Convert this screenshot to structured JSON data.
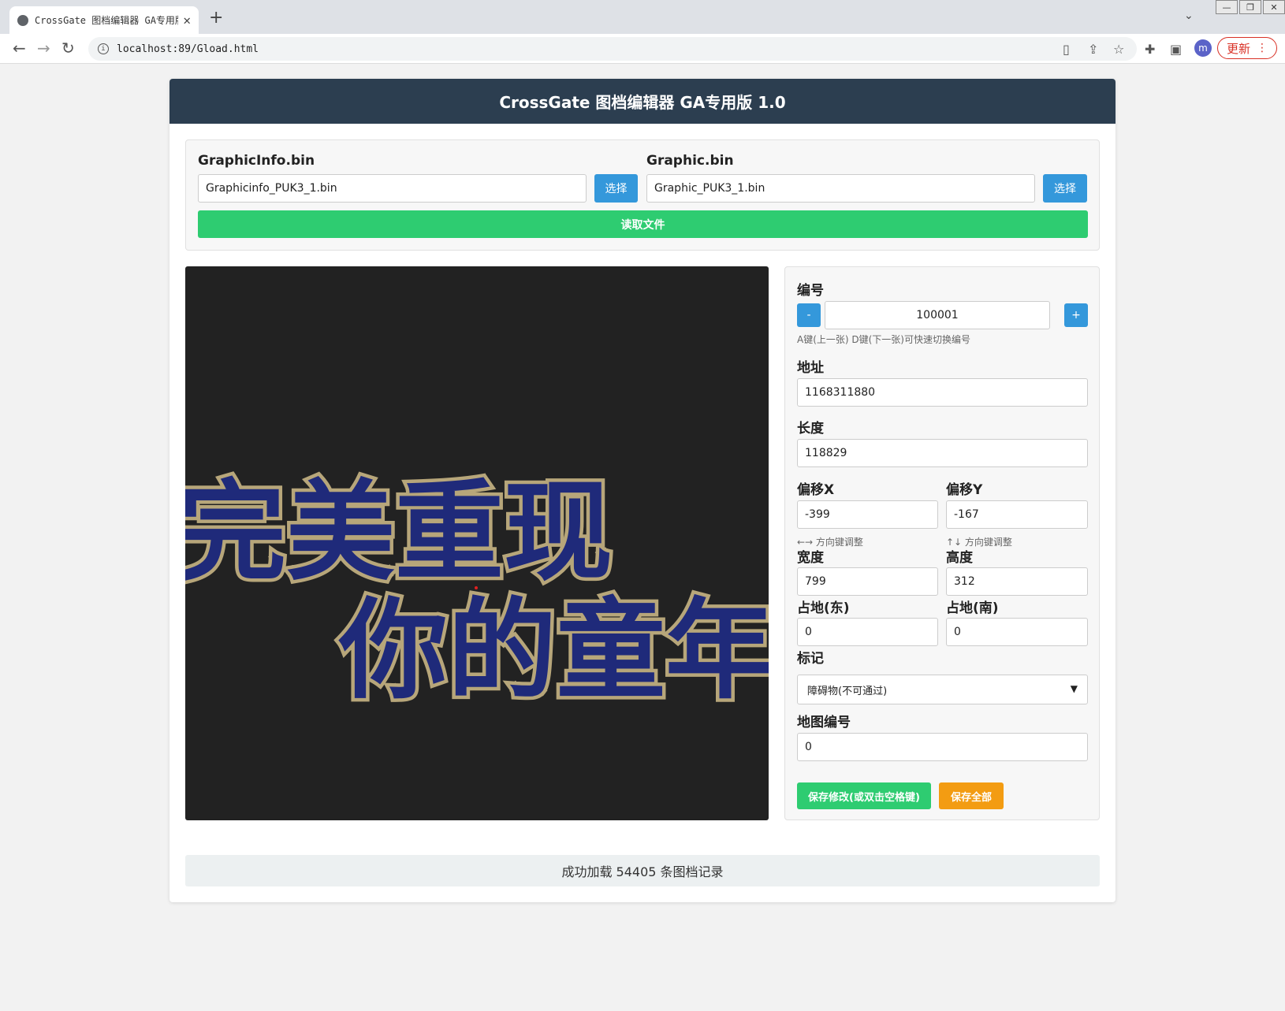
{
  "browser": {
    "tab_title": "CrossGate 图档编辑器 GA专用版",
    "url": "localhost:89/Gload.html",
    "profile_initial": "m",
    "update_label": "更新"
  },
  "app": {
    "title": "CrossGate 图档编辑器 GA专用版 1.0",
    "files": {
      "info_label": "GraphicInfo.bin",
      "info_value": "Graphicinfo_PUK3_1.bin",
      "graphic_label": "Graphic.bin",
      "graphic_value": "Graphic_PUK3_1.bin",
      "choose_label": "选择",
      "read_label": "读取文件"
    },
    "preview": {
      "line1": "完美重现",
      "line2": "你的童年"
    },
    "props": {
      "id_label": "编号",
      "id_value": "100001",
      "dec_label": "-",
      "inc_label": "+",
      "id_hint": "A键(上一张) D键(下一张)可快速切换编号",
      "addr_label": "地址",
      "addr_value": "1168311880",
      "len_label": "长度",
      "len_value": "118829",
      "offx_label": "偏移X",
      "offx_value": "-399",
      "offy_label": "偏移Y",
      "offy_value": "-167",
      "offx_hint": "←→ 方向键调整",
      "offy_hint": "↑↓ 方向键调整",
      "width_label": "宽度",
      "width_value": "799",
      "height_label": "高度",
      "height_value": "312",
      "east_label": "占地(东)",
      "east_value": "0",
      "south_label": "占地(南)",
      "south_value": "0",
      "mark_label": "标记",
      "mark_value": "障碍物(不可通过)",
      "map_label": "地图编号",
      "map_value": "0",
      "save_label": "保存修改(或双击空格键)",
      "save_all_label": "保存全部"
    },
    "status": "成功加载 54405 条图档记录"
  },
  "colors": {
    "header": "#2c3e50",
    "accent_blue": "#3498db",
    "accent_green": "#2ecc71",
    "accent_orange": "#f39c12",
    "preview_bg": "#222222",
    "glyph_fill": "#1f2a7a",
    "glyph_outline": "#b7a67a"
  }
}
